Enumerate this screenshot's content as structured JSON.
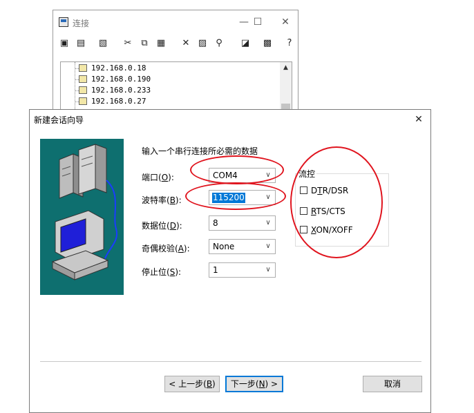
{
  "connect_window": {
    "title": "连接",
    "minimize": "—",
    "maximize": "☐",
    "close": "✕",
    "hosts": [
      "192.168.0.18",
      "192.168.0.190",
      "192.168.0.233",
      "192.168.0.27"
    ]
  },
  "dialog": {
    "title": "新建会话向导",
    "close": "✕",
    "heading": "输入一个串行连接所必需的数据",
    "fields": [
      {
        "label": "端口(",
        "key": "O",
        "suffix": "):",
        "value": "COM4"
      },
      {
        "label": "波特率(",
        "key": "B",
        "suffix": "):",
        "value": "115200"
      },
      {
        "label": "数据位(",
        "key": "D",
        "suffix": "):",
        "value": "8"
      },
      {
        "label": "奇偶校验(",
        "key": "A",
        "suffix": "):",
        "value": "None"
      },
      {
        "label": "停止位(",
        "key": "S",
        "suffix": "):",
        "value": "1"
      }
    ],
    "flow_control": {
      "legend": "流控",
      "options": [
        {
          "pre": "D",
          "key": "T",
          "post": "R/DSR",
          "checked": false
        },
        {
          "pre": "",
          "key": "R",
          "post": "TS/CTS",
          "checked": false
        },
        {
          "pre": "",
          "key": "X",
          "post": "ON/XOFF",
          "checked": false
        }
      ]
    },
    "buttons": {
      "back": {
        "pre": "< 上一步(",
        "key": "B",
        "post": ")"
      },
      "next": {
        "pre": "下一步(",
        "key": "N",
        "post": ") >"
      },
      "cancel": "取消"
    }
  },
  "colors": {
    "annotation": "#e0141e",
    "selection": "#0078d7",
    "picture_bg": "#0e6f6f"
  }
}
